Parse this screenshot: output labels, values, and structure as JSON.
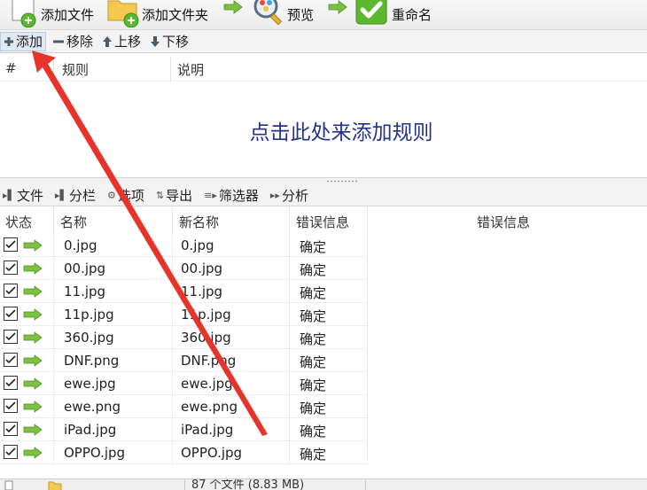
{
  "toolbar": {
    "add_files": "添加文件",
    "add_folder": "添加文件夹",
    "preview": "预览",
    "rename": "重命名"
  },
  "rules_toolbar": {
    "add": "添加",
    "remove": "移除",
    "move_up": "上移",
    "move_down": "下移"
  },
  "rules_table": {
    "columns": [
      "#",
      "规则",
      "说明"
    ],
    "empty_hint": "点击此处来添加规则"
  },
  "files_toolbar": {
    "file": "文件",
    "columns": "分栏",
    "options": "选项",
    "export": "导出",
    "filter": "筛选器",
    "analyze": "分析"
  },
  "files_table": {
    "columns": [
      "状态",
      "名称",
      "新名称",
      "错误信息",
      "错误信息"
    ],
    "rows": [
      {
        "name": "0.jpg",
        "new_name": "0.jpg",
        "error": "确定"
      },
      {
        "name": "00.jpg",
        "new_name": "00.jpg",
        "error": "确定"
      },
      {
        "name": "11.jpg",
        "new_name": "11.jpg",
        "error": "确定"
      },
      {
        "name": "11p.jpg",
        "new_name": "11p.jpg",
        "error": "确定"
      },
      {
        "name": "360.jpg",
        "new_name": "360.jpg",
        "error": "确定"
      },
      {
        "name": "DNF.png",
        "new_name": "DNF.png",
        "error": "确定"
      },
      {
        "name": "ewe.jpg",
        "new_name": "ewe.jpg",
        "error": "确定"
      },
      {
        "name": "ewe.png",
        "new_name": "ewe.png",
        "error": "确定"
      },
      {
        "name": "iPad.jpg",
        "new_name": "iPad.jpg",
        "error": "确定"
      },
      {
        "name": "OPPO.jpg",
        "new_name": "OPPO.jpg",
        "error": "确定"
      }
    ]
  },
  "status_bar": {
    "file_count": "87 个文件 (8.83 MB)"
  },
  "colors": {
    "accent_green": "#5cb82e",
    "hint_text": "#24338a",
    "annotation_red": "#e8332a"
  }
}
